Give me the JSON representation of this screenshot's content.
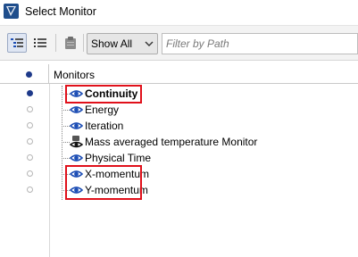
{
  "window": {
    "title": "Select Monitor"
  },
  "toolbar": {
    "filter_option": "Show All",
    "filter_placeholder": "Filter by Path"
  },
  "table": {
    "column_header": "Monitors",
    "rows": [
      {
        "label": "Continuity",
        "bold": true,
        "selected": true,
        "icon": "eye-icon",
        "highlighted": true
      },
      {
        "label": "Energy",
        "bold": false,
        "selected": false,
        "icon": "eye-icon",
        "highlighted": false
      },
      {
        "label": "Iteration",
        "bold": false,
        "selected": false,
        "icon": "eye-icon",
        "highlighted": false
      },
      {
        "label": "Mass averaged temperature Monitor",
        "bold": false,
        "selected": false,
        "icon": "monitor-eye-icon",
        "highlighted": false
      },
      {
        "label": "Physical Time",
        "bold": false,
        "selected": false,
        "icon": "eye-icon",
        "highlighted": false
      },
      {
        "label": "X-momentum",
        "bold": false,
        "selected": false,
        "icon": "eye-icon",
        "highlighted": true
      },
      {
        "label": "Y-momentum",
        "bold": false,
        "selected": false,
        "icon": "eye-icon",
        "highlighted": true
      }
    ]
  },
  "colors": {
    "highlight": "#e0101a",
    "selected_radio": "#1e3a8a",
    "eye_icon": "#1e4fb5"
  }
}
